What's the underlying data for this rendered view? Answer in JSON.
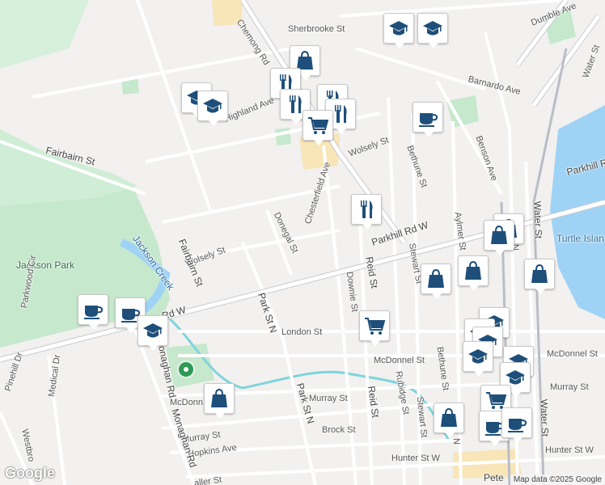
{
  "map": {
    "attribution": "Map data ©2025 Google",
    "logo": "Google",
    "colors": {
      "land": "#f2f1ef",
      "road": "#ffffff",
      "arterial": "#c9cbd1",
      "park": "#c6e8cd",
      "water": "#9fd3f5",
      "creek": "#7fd4dd",
      "building": "#f8e5b8",
      "marker_icon": "#1e4f7a"
    }
  },
  "labels": {
    "chemong": "Chemong Rd",
    "sherbrooke_top": "Sherbrooke St",
    "dumble": "Dumble Ave",
    "water_st_top": "Water St",
    "highland": "Highland Ave",
    "barnardo": "Barnardo Ave",
    "wolsely_top": "Wolsely St",
    "fairbairn_st": "Fairbairn St",
    "benson": "Benson Ave",
    "bethune_top": "Bethune St",
    "chesterfield": "Chesterfield Ave",
    "parkhill_right": "Parkhill R",
    "parkhill_rd_w": "Parkhill Rd W",
    "turtle_island": "Turtle Islan",
    "wolsely_left": "Wolsely St",
    "donegal": "Donegal St",
    "stewart_top": "Stewart St",
    "aylmer": "Aylmer St",
    "jackson_park": "Jackson Park",
    "jackson_creek": "Jackson Creek",
    "fairbairn_vert": "Fairbairn St",
    "reid_top": "Reid St",
    "downie": "Downie St",
    "rd_w": "Rd W",
    "park_st_n_top": "Park St N",
    "parkwood": "Parkwood Cir",
    "london": "London St",
    "monaghan_top": "Monaghan Rd",
    "medical": "Medical Dr",
    "mcdonnel_mid": "McDonnel St",
    "mcdonnel_right": "McDonnel St",
    "pinehill": "Pinehill Dr",
    "bethune_low": "Bethune St",
    "murray_right": "Murray St",
    "murray_mid": "Murray St",
    "mcdonn_left": "McDonn",
    "park_st_n_low": "Park St N",
    "reid_low": "Reid St",
    "rubidge": "Rubidge St",
    "stewart_low": "Stewart St",
    "murray_left": "Murray St",
    "brock": "Brock St",
    "hopkins": "Hopkins Ave",
    "hunter_right": "Hunter St W",
    "hunter_mid": "Hunter St W",
    "monaghan_low": "Monaghan Rd",
    "westbrook": "Westbro",
    "geo": "Ge",
    "water_st_mid": "Water St",
    "water_st_low": "Water St",
    "a_st": "A",
    "n_st": "N",
    "peterborough": "Pete",
    "aller": "aller St"
  },
  "markers": [
    {
      "id": "school-top-1",
      "icon": "school"
    },
    {
      "id": "school-top-2",
      "icon": "school"
    },
    {
      "id": "shop-chemong",
      "icon": "shopping"
    },
    {
      "id": "restaurant-1",
      "icon": "restaurant"
    },
    {
      "id": "restaurant-2",
      "icon": "restaurant"
    },
    {
      "id": "restaurant-3",
      "icon": "restaurant"
    },
    {
      "id": "restaurant-4",
      "icon": "restaurant"
    },
    {
      "id": "grocery-chemong",
      "icon": "grocery"
    },
    {
      "id": "school-highland-1",
      "icon": "school"
    },
    {
      "id": "school-highland-2",
      "icon": "school"
    },
    {
      "id": "cafe-barnardo",
      "icon": "cafe"
    },
    {
      "id": "restaurant-parkhill",
      "icon": "restaurant"
    },
    {
      "id": "shop-geo-1",
      "icon": "shopping"
    },
    {
      "id": "shop-geo-2",
      "icon": "shopping"
    },
    {
      "id": "shop-stewart-1",
      "icon": "shopping"
    },
    {
      "id": "shop-stewart-2",
      "icon": "shopping"
    },
    {
      "id": "shop-water",
      "icon": "shopping"
    },
    {
      "id": "cafe-left",
      "icon": "cafe"
    },
    {
      "id": "cafe-left-2",
      "icon": "cafe"
    },
    {
      "id": "school-left",
      "icon": "school"
    },
    {
      "id": "grocery-london",
      "icon": "grocery"
    },
    {
      "id": "school-downtown-1",
      "icon": "school"
    },
    {
      "id": "school-downtown-2",
      "icon": "school"
    },
    {
      "id": "school-downtown-3",
      "icon": "school"
    },
    {
      "id": "school-downtown-4",
      "icon": "school"
    },
    {
      "id": "school-downtown-5",
      "icon": "school"
    },
    {
      "id": "school-downtown-6",
      "icon": "school"
    },
    {
      "id": "grocery-downtown",
      "icon": "grocery"
    },
    {
      "id": "shop-murray",
      "icon": "shopping"
    },
    {
      "id": "shop-downtown",
      "icon": "shopping"
    },
    {
      "id": "cafe-downtown-1",
      "icon": "cafe"
    },
    {
      "id": "cafe-downtown-2",
      "icon": "cafe"
    }
  ]
}
